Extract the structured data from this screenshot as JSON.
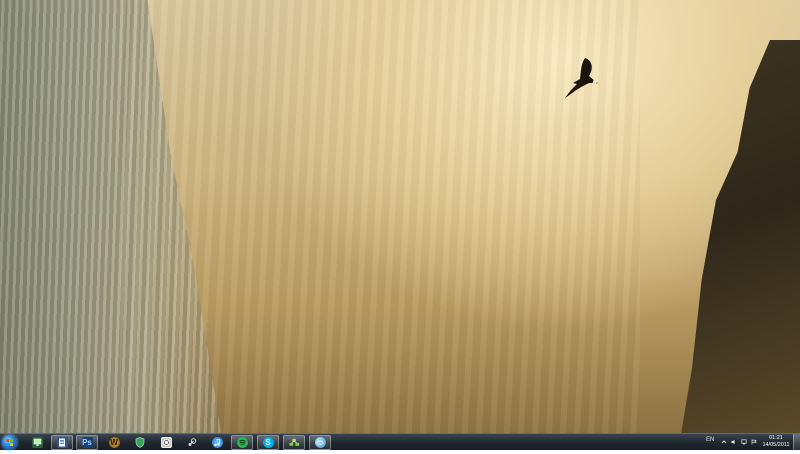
{
  "desktop": {
    "wallpaper": "waterfall-mist-eagle"
  },
  "taskbar": {
    "pinned": [
      {
        "name": "start-button",
        "icon": "windows-logo-icon"
      },
      {
        "name": "explorer",
        "icon": "monitor-icon"
      },
      {
        "name": "word",
        "icon": "word-document-icon"
      },
      {
        "name": "photoshop",
        "icon": "photoshop-icon",
        "text": "Ps"
      },
      {
        "name": "wow",
        "icon": "wow-icon",
        "text": "W"
      },
      {
        "name": "security",
        "icon": "shield-icon"
      },
      {
        "name": "paint",
        "icon": "notepad-icon"
      },
      {
        "name": "steam",
        "icon": "steam-icon"
      },
      {
        "name": "itunes",
        "icon": "music-note-icon"
      },
      {
        "name": "spotify",
        "icon": "spotify-icon"
      },
      {
        "name": "skype",
        "icon": "skype-icon",
        "text": "S"
      },
      {
        "name": "network",
        "icon": "network-icon"
      },
      {
        "name": "tool",
        "icon": "globe-icon"
      }
    ],
    "tray": {
      "language": "EN",
      "time": "01:21",
      "date": "14/05/2011"
    }
  },
  "colors": {
    "taskbar": "#1f262e",
    "accent_blue": "#2a7fd0",
    "photoshop": "#1d3f74",
    "spotify": "#1db954",
    "skype": "#00aff0"
  }
}
